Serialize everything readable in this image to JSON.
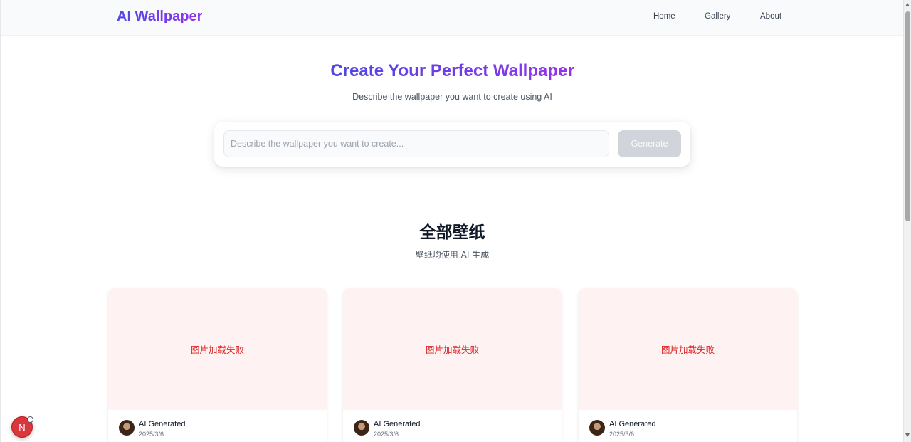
{
  "header": {
    "logo": "AI Wallpaper",
    "nav": [
      "Home",
      "Gallery",
      "About"
    ]
  },
  "hero": {
    "title": "Create Your Perfect Wallpaper",
    "subtitle": "Describe the wallpaper you want to create using AI",
    "input_placeholder": "Describe the wallpaper you want to create...",
    "input_value": "",
    "generate_label": "Generate"
  },
  "gallery": {
    "title": "全部壁纸",
    "subtitle": "壁纸均使用 AI 生成",
    "cards": [
      {
        "image_error": "图片加载失败",
        "author": "AI Generated",
        "date": "2025/3/6"
      },
      {
        "image_error": "图片加载失败",
        "author": "AI Generated",
        "date": "2025/3/6"
      },
      {
        "image_error": "图片加载失败",
        "author": "AI Generated",
        "date": "2025/3/6"
      }
    ]
  },
  "dev_badge": {
    "letter": "N"
  },
  "colors": {
    "brand_gradient_start": "#4f46e5",
    "brand_gradient_end": "#9333ea",
    "error_text": "#dc2626",
    "error_bg": "#fef2f2",
    "button_disabled": "#d1d5db"
  }
}
